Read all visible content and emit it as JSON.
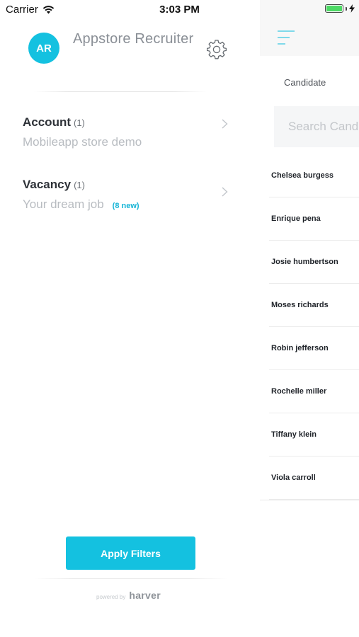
{
  "status_bar": {
    "carrier": "Carrier",
    "time": "3:03 PM",
    "battery_level": 1.0,
    "battery_color": "#4cd964"
  },
  "drawer": {
    "profile": {
      "initials": "AR",
      "name": "Appstore Recruiter",
      "avatar_color": "#14c1e0",
      "settings_icon": "gear-icon"
    },
    "filters": [
      {
        "title": "Account",
        "count": "(1)",
        "subtitle": "Mobileapp store demo",
        "badge": ""
      },
      {
        "title": "Vacancy",
        "count": "(1)",
        "subtitle": "Your dream job",
        "badge": "(8 new)"
      }
    ],
    "apply_button_label": "Apply Filters",
    "footer": {
      "powered_label": "powered by",
      "brand": "harver"
    }
  },
  "main": {
    "menu_icon": "hamburger-menu-icon",
    "section_label": "Candidate",
    "search_placeholder": "Search Candidates",
    "candidates": [
      "Chelsea burgess",
      "Enrique pena",
      "Josie humbertson",
      "Moses richards",
      "Robin jefferson",
      "Rochelle miller",
      "Tiffany klein",
      "Viola carroll"
    ]
  },
  "colors": {
    "accent": "#14c1e0",
    "badge": "#14b4d6"
  }
}
